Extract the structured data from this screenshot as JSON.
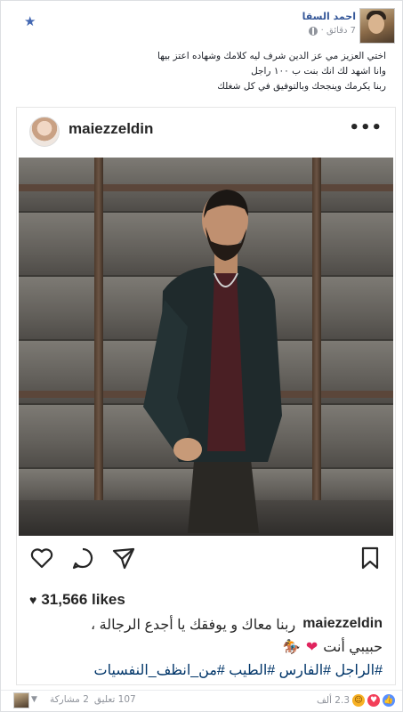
{
  "post": {
    "author": "احمد السقا",
    "time": "7 دقائق ·",
    "caption_lines": [
      "اختي العزيز مي عز الدين شرف ليه كلامك وشهاده اعتز بيها",
      "وانا اشهد لك انك بنت ب ١٠٠ راجل",
      "ربنا يكرمك وينجحك وبالتوفيق في كل شغلك"
    ]
  },
  "instagram": {
    "username": "maiezzeldin",
    "more_label": "•••",
    "likes": "31,566 likes",
    "caption_user": "maiezzeldin",
    "caption_text": "ربنا معاك و يوفقك يا أجدع الرجالة ،",
    "caption_line2": "حبيبي أنت",
    "hashtags": "#الراجل #الفارس #الطيب #من_انظف_النفسيات"
  },
  "footer": {
    "reactions_count": "2.3 ألف",
    "comments": "107 تعليق",
    "shares": "2 مشاركة"
  },
  "colors": {
    "link": "#365899",
    "meta": "#90949c",
    "hashtag": "#003569",
    "love": "#f33e58",
    "haha": "#f7b125",
    "like": "#5890ff"
  },
  "icons": {
    "star": "star-icon",
    "globe": "globe-icon",
    "heart": "heart-icon",
    "comment": "comment-icon",
    "share": "share-icon",
    "save": "bookmark-icon"
  }
}
